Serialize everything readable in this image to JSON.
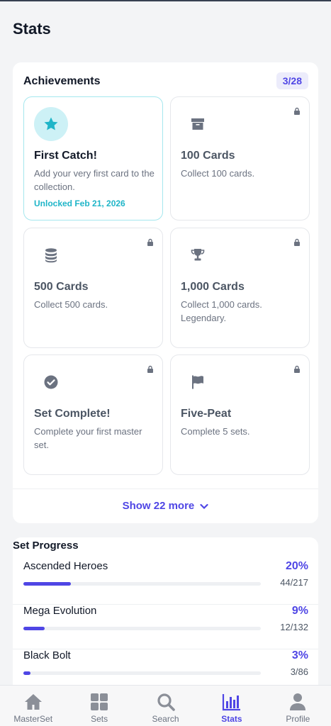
{
  "page": {
    "title": "Stats"
  },
  "achievements": {
    "header": "Achievements",
    "count": "3/28",
    "items": [
      {
        "title": "First Catch!",
        "desc": "Add your very first card to the collection.",
        "date": "Unlocked Feb 21, 2026",
        "icon": "star-icon",
        "unlocked": true
      },
      {
        "title": "100 Cards",
        "desc": "Collect 100 cards.",
        "icon": "archive-box-icon",
        "unlocked": false
      },
      {
        "title": "500 Cards",
        "desc": "Collect 500 cards.",
        "icon": "coin-stack-icon",
        "unlocked": false
      },
      {
        "title": "1,000 Cards",
        "desc": "Collect 1,000 cards. Legendary.",
        "icon": "trophy-icon",
        "unlocked": false
      },
      {
        "title": "Set Complete!",
        "desc": "Complete your first master set.",
        "icon": "check-circle-icon",
        "unlocked": false
      },
      {
        "title": "Five-Peat",
        "desc": "Complete 5 sets.",
        "icon": "flag-icon",
        "unlocked": false
      }
    ],
    "show_more": "Show 22 more"
  },
  "set_progress": {
    "header": "Set Progress",
    "sets": [
      {
        "name": "Ascended Heroes",
        "pct": "20%",
        "count": "44/217",
        "progress": 0.2
      },
      {
        "name": "Mega Evolution",
        "pct": "9%",
        "count": "12/132",
        "progress": 0.09
      },
      {
        "name": "Black Bolt",
        "pct": "3%",
        "count": "3/86",
        "progress": 0.03
      }
    ]
  },
  "nav": {
    "items": [
      {
        "label": "MasterSet",
        "icon": "home-icon",
        "active": false
      },
      {
        "label": "Sets",
        "icon": "grid-icon",
        "active": false
      },
      {
        "label": "Search",
        "icon": "search-icon",
        "active": false
      },
      {
        "label": "Stats",
        "icon": "bar-chart-icon",
        "active": true
      },
      {
        "label": "Profile",
        "icon": "user-icon",
        "active": false
      }
    ]
  },
  "colors": {
    "accent": "#4f46e5",
    "teal": "#1fb5c8",
    "icon_gray": "#6b7280"
  }
}
